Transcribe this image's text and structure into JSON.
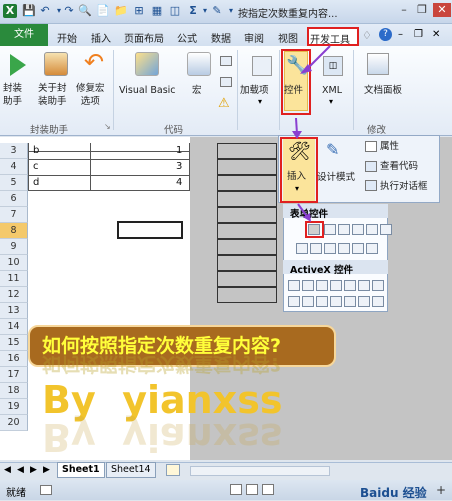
{
  "window": {
    "title": "按指定次数重复内容..."
  },
  "tabs": [
    "文件",
    "开始",
    "插入",
    "页面布局",
    "公式",
    "数据",
    "审阅",
    "视图",
    "开发工具"
  ],
  "ribbon": {
    "buttons": {
      "fengzhuang": "封装\n助手",
      "about": "关于封\n装助手",
      "repair": "修复宏\n选项",
      "vba": "Visual Basic",
      "macro": "宏",
      "addins": "加载项",
      "controls": "控件",
      "xml": "XML",
      "docpanel": "文档面板"
    },
    "groups": {
      "g1": "封装助手",
      "g2": "代码",
      "g3": "修改"
    }
  },
  "controls_popup": {
    "insert": "插入",
    "design_mode": "设计模式",
    "properties": "属性",
    "view_code": "查看代码",
    "run_dialog": "执行对话框",
    "form_controls": "表单控件",
    "activex_controls": "ActiveX 控件"
  },
  "rows": [
    "3",
    "4",
    "5",
    "6",
    "7",
    "8",
    "9",
    "10",
    "11",
    "12",
    "13",
    "14",
    "15",
    "16",
    "17",
    "18",
    "19",
    "20"
  ],
  "cells": [
    {
      "a": "b",
      "b": "1"
    },
    {
      "a": "c",
      "b": "3"
    },
    {
      "a": "d",
      "b": "4"
    }
  ],
  "overlay": {
    "question": "如何按照指定次数重复内容?",
    "author": "By  yianxss"
  },
  "sheet_tabs": [
    "Sheet1",
    "Sheet14"
  ],
  "status": {
    "ready": "就绪",
    "watermark": "Baidu 经验"
  }
}
